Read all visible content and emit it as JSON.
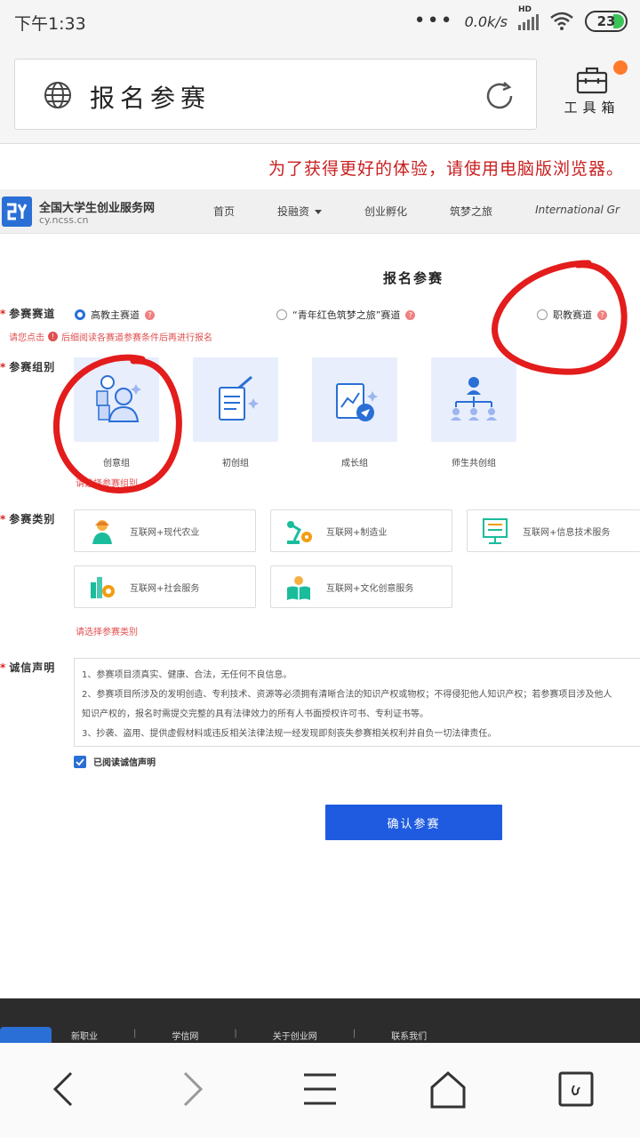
{
  "status_bar": {
    "time": "下午1:33",
    "dots": "•••",
    "speed": "0.0k/s",
    "signal_label": "HD",
    "battery": "23"
  },
  "browser": {
    "page_title": "报名参赛",
    "toolbox_label": "工具箱"
  },
  "notice": "为了获得更好的体验，请使用电脑版浏览器。",
  "site": {
    "name": "全国大学生创业服务网",
    "domain": "cy.ncss.cn",
    "nav": [
      "首页",
      "投融资",
      "创业孵化",
      "筑梦之旅",
      "International Gr"
    ]
  },
  "form": {
    "title": "报名参赛",
    "track_label": "参赛赛道",
    "tracks": [
      "高教主赛道",
      "“青年红色筑梦之旅”赛道",
      "职教赛道"
    ],
    "track_hint_prefix": "请您点击",
    "track_hint": "后细阅读各赛道参赛条件后再进行报名",
    "group_label": "参赛组别",
    "groups": [
      "创意组",
      "初创组",
      "成长组",
      "师生共创组"
    ],
    "group_hint": "请选择参赛组别",
    "category_label": "参赛类别",
    "categories": [
      "互联网+现代农业",
      "互联网+制造业",
      "互联网+信息技术服务",
      "互联网+社会服务",
      "互联网+文化创意服务"
    ],
    "category_hint": "请选择参赛类别",
    "statement_label": "诚信声明",
    "statement_lines": [
      "1、参赛项目须真实、健康、合法，无任何不良信息。",
      "2、参赛项目所涉及的发明创造、专利技术、资源等必须拥有清晰合法的知识产权或物权；不得侵犯他人知识产权；若参赛项目涉及他人",
      "知识产权的，报名时需提交完整的具有法律效力的所有人书面授权许可书、专利证书等。",
      "3、抄袭、盗用、提供虚假材料或违反相关法律法规一经发现即刻丧失参赛相关权利并自负一切法律责任。"
    ],
    "agree_label": "已阅读诚信声明",
    "confirm_label": "确认参赛"
  },
  "footer": {
    "links": [
      "新职业",
      "学信网",
      "关于创业网",
      "联系我们"
    ]
  },
  "colors": {
    "accent": "#1e5be0",
    "required": "#e02020",
    "annotation": "#e31c1c"
  }
}
